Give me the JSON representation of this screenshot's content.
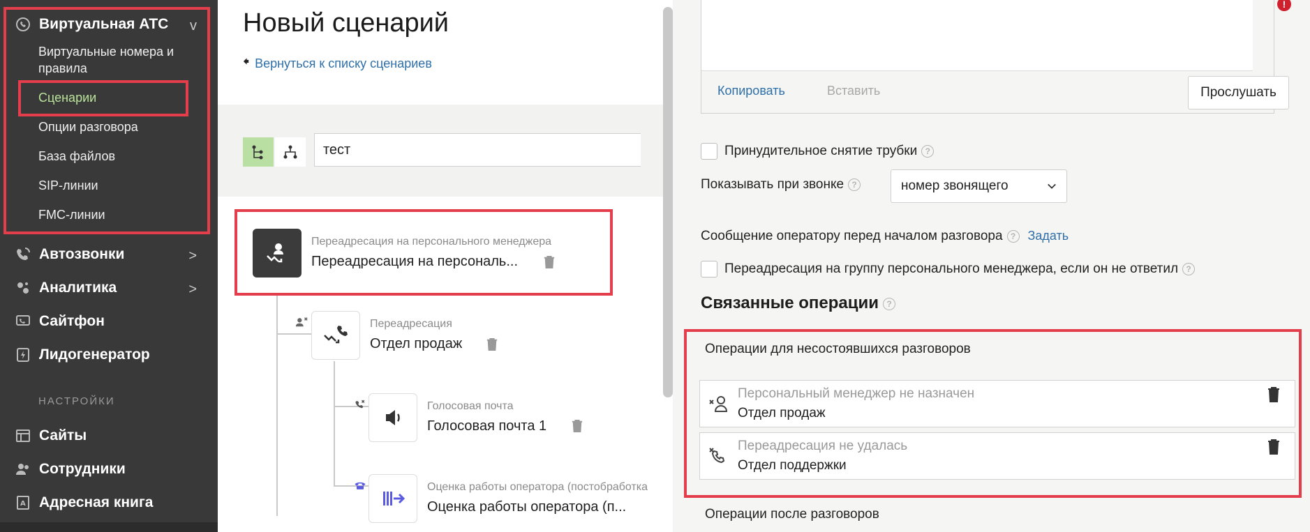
{
  "sidebar": {
    "items": [
      {
        "label": "Виртуальная АТС",
        "chevron": "v",
        "icon": "phone-cloud-icon"
      },
      {
        "label": "Автозвонки",
        "chevron": ">",
        "icon": "autocall-icon"
      },
      {
        "label": "Аналитика",
        "chevron": ">",
        "icon": "analytics-icon"
      },
      {
        "label": "Сайтфон",
        "chevron": "",
        "icon": "sitephone-icon"
      },
      {
        "label": "Лидогенератор",
        "chevron": "",
        "icon": "leadgen-icon"
      }
    ],
    "sub_items": [
      {
        "label": "Виртуальные номера и правила"
      },
      {
        "label": "Сценарии"
      },
      {
        "label": "Опции разговора"
      },
      {
        "label": "База файлов"
      },
      {
        "label": "SIP-линии"
      },
      {
        "label": "FMC-линии"
      }
    ],
    "settings_label": "НАСТРОЙКИ",
    "settings_items": [
      {
        "label": "Сайты",
        "icon": "sites-icon"
      },
      {
        "label": "Сотрудники",
        "icon": "employees-icon"
      },
      {
        "label": "Адресная книга",
        "icon": "address-book-icon"
      }
    ]
  },
  "middle": {
    "title": "Новый сценарий",
    "back_link": "Вернуться к списку сценариев",
    "search_value": "тест",
    "operations": [
      {
        "type": "Переадресация на персонального менеджера",
        "name": "Переадресация на персональ..."
      },
      {
        "type": "Переадресация",
        "name": "Отдел продаж"
      },
      {
        "type": "Голосовая почта",
        "name": "Голосовая почта 1"
      },
      {
        "type": "Оценка работы оператора (постобработка",
        "name": "Оценка работы оператора (п..."
      }
    ]
  },
  "right": {
    "copy_label": "Копировать",
    "paste_label": "Вставить",
    "listen_label": "Прослушать",
    "force_pickup_label": "Принудительное снятие трубки",
    "show_on_call_label": "Показывать при звонке",
    "show_on_call_value": "номер звонящего",
    "operator_message_label": "Сообщение оператору перед началом разговора",
    "set_link": "Задать",
    "group_redirect_label": "Переадресация на группу персонального менеджера, если он не ответил",
    "linked_title": "Связанные операции",
    "failed_calls_heading": "Операции для несостоявшихся разговоров",
    "linked_ops": [
      {
        "condition": "Персональный менеджер не назначен",
        "target": "Отдел продаж"
      },
      {
        "condition": "Переадресация не удалась",
        "target": "Отдел поддержки"
      }
    ],
    "after_calls_heading": "Операции после разговоров"
  },
  "colors": {
    "sidebar_bg": "#393939",
    "accent_green": "#b9e39a",
    "link_blue": "#2f6fa8",
    "highlight_red": "#e43d4c"
  }
}
